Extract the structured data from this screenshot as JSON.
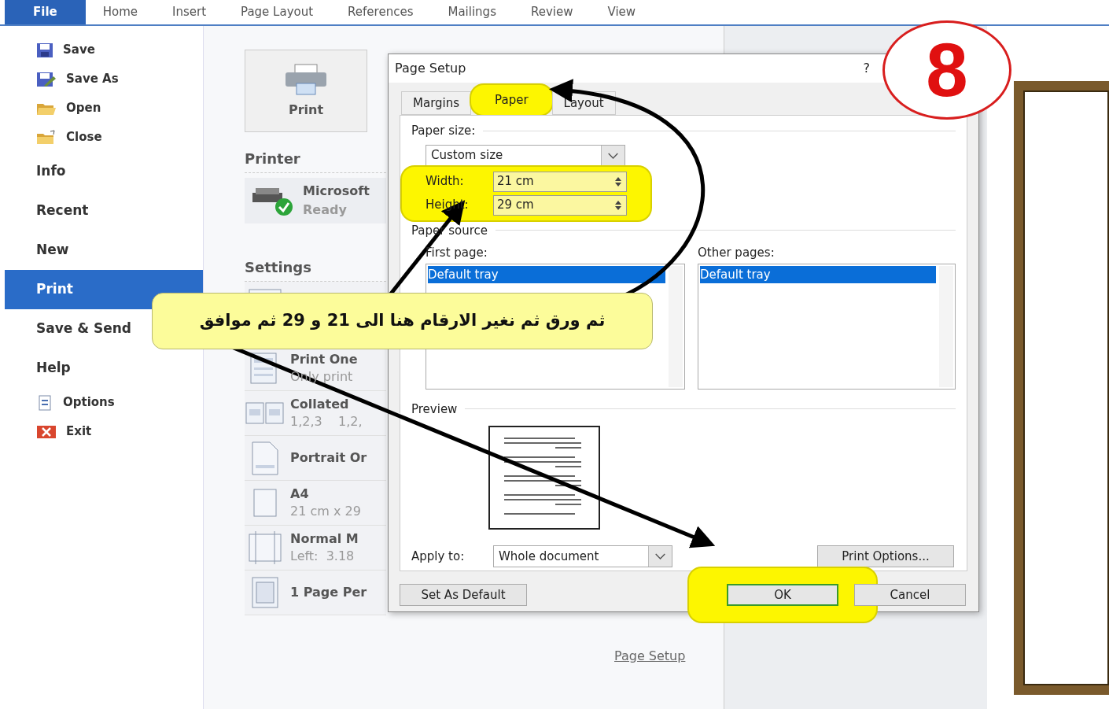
{
  "ribbon_tabs": [
    {
      "label": "File",
      "selected": true
    },
    {
      "label": "Home",
      "selected": false
    },
    {
      "label": "Insert",
      "selected": false
    },
    {
      "label": "Page Layout",
      "selected": false
    },
    {
      "label": "References",
      "selected": false
    },
    {
      "label": "Mailings",
      "selected": false
    },
    {
      "label": "Review",
      "selected": false
    },
    {
      "label": "View",
      "selected": false
    }
  ],
  "backstage_menu": [
    {
      "label": "Save",
      "kind": "command"
    },
    {
      "label": "Save As",
      "kind": "command"
    },
    {
      "label": "Open",
      "kind": "command"
    },
    {
      "label": "Close",
      "kind": "command"
    },
    {
      "label": "Info",
      "kind": "section",
      "selected": false
    },
    {
      "label": "Recent",
      "kind": "section",
      "selected": false
    },
    {
      "label": "New",
      "kind": "section",
      "selected": false
    },
    {
      "label": "Print",
      "kind": "section",
      "selected": true
    },
    {
      "label": "Save & Send",
      "kind": "section",
      "selected": false
    },
    {
      "label": "Help",
      "kind": "section",
      "selected": false
    },
    {
      "label": "Options",
      "kind": "command"
    },
    {
      "label": "Exit",
      "kind": "command"
    }
  ],
  "print_panel": {
    "print_button": "Print",
    "printer_heading": "Printer",
    "printer": {
      "name": "Microsoft",
      "status": "Ready"
    },
    "settings_heading": "Settings",
    "settings": [
      {
        "kind": "pages"
      },
      {
        "kind": "sides",
        "title": "Print One",
        "subtitle": "Only print"
      },
      {
        "kind": "collate",
        "title": "Collated",
        "subtitle": "1,2,3    1,2,"
      },
      {
        "kind": "orientation",
        "title": "Portrait Or"
      },
      {
        "kind": "size",
        "title": "A4",
        "subtitle": "21 cm x 29"
      },
      {
        "kind": "margins",
        "title": "Normal M",
        "subtitle": "Left:  3.18"
      },
      {
        "kind": "persheet",
        "title": "1 Page Per"
      }
    ],
    "page_setup_link": "Page Setup"
  },
  "dialog": {
    "title": "Page Setup",
    "help": "?",
    "tabs": [
      {
        "label": "Margins",
        "selected": false
      },
      {
        "label": "Paper",
        "selected": true
      },
      {
        "label": "Layout",
        "selected": false
      }
    ],
    "paper_size_label": "Paper size:",
    "paper_size": "Custom size",
    "width": {
      "label": "Width:",
      "value": "21 cm"
    },
    "height": {
      "label": "Height:",
      "value": "29 cm"
    },
    "paper_source_label": "Paper source",
    "first_page_label": "First page:",
    "first_page_items": [
      {
        "label": "Default tray",
        "selected": true
      }
    ],
    "other_pages_label": "Other pages:",
    "other_pages_items": [
      {
        "label": "Default tray",
        "selected": true
      }
    ],
    "preview_label": "Preview",
    "apply_to_label": "Apply to:",
    "apply_to": "Whole document",
    "print_options": "Print Options...",
    "set_default": "Set As Default",
    "ok": "OK",
    "cancel": "Cancel"
  },
  "annotations": {
    "step_number": "8",
    "callout": "ثم ورق ثم نغير الارقام هنا الى 21 و 29 ثم موافق",
    "highlight_paper_tab": true,
    "highlight_size_fields": true,
    "highlight_ok": true
  }
}
